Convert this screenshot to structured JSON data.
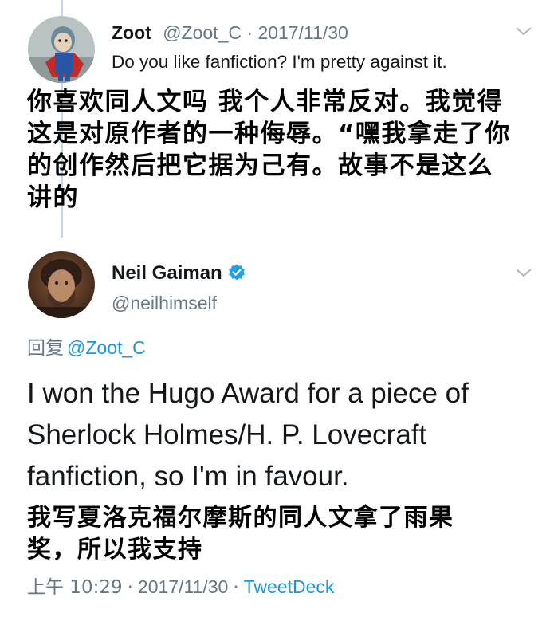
{
  "tweet1": {
    "name": "Zoot",
    "handle": "@Zoot_C",
    "separator": "·",
    "date": "2017/11/30",
    "text": "Do you like fanfiction? I'm pretty against it.",
    "translation_lines": [
      "你喜欢同人文吗 我个人非常反对。我觉得",
      "这是对原作者的一种侮辱。“嘿我拿走了你",
      "的创作然后把它据为己有。故事不是这么",
      "讲的"
    ]
  },
  "tweet2": {
    "name": "Neil Gaiman",
    "handle": "@neilhimself",
    "verified": true,
    "reply_prefix": "回复",
    "reply_to": "@Zoot_C",
    "text_lines": [
      "I won the Hugo Award for a piece of",
      "Sherlock Holmes/H. P. Lovecraft",
      "fanfiction, so I'm in favour."
    ],
    "translation_lines": [
      "我写夏洛克福尔摩斯的同人文拿了雨果",
      "奖，所以我支持"
    ],
    "time": "上午 10:29",
    "separator": "·",
    "date": "2017/11/30",
    "source": "TweetDeck"
  },
  "colors": {
    "link": "#1b95e0",
    "muted": "#657786",
    "thread_line": "#ccd6dd",
    "verified_badge": "#1da1f2"
  },
  "icons": [
    "chevron-down-icon",
    "verified-badge-icon"
  ]
}
